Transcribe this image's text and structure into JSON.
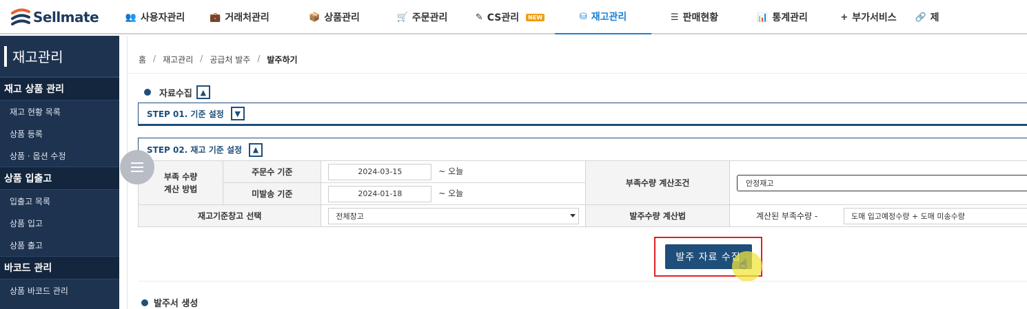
{
  "brand": {
    "name": "Sellmate"
  },
  "nav": [
    {
      "label": "사용자관리",
      "icon": "users-icon",
      "glyph": "👥",
      "active": false
    },
    {
      "label": "거래처관리",
      "icon": "briefcase-icon",
      "glyph": "💼",
      "active": false
    },
    {
      "label": "상품관리",
      "icon": "box-icon",
      "glyph": "📦",
      "active": false
    },
    {
      "label": "주문관리",
      "icon": "cart-icon",
      "glyph": "🛒",
      "active": false
    },
    {
      "label": "CS관리",
      "icon": "edit-icon",
      "glyph": "✎",
      "active": false,
      "badge": "NEW"
    },
    {
      "label": "재고관리",
      "icon": "cubes-icon",
      "glyph": "⛁",
      "active": true
    },
    {
      "label": "판매현황",
      "icon": "list-icon",
      "glyph": "☰",
      "active": false
    },
    {
      "label": "통계관리",
      "icon": "bar-chart-icon",
      "glyph": "📊",
      "active": false
    },
    {
      "label": "부가서비스",
      "icon": "plus-icon",
      "glyph": "+",
      "active": false
    },
    {
      "label": "제",
      "icon": "link-icon",
      "glyph": "🔗",
      "active": false
    }
  ],
  "sidebar": {
    "title": "재고관리",
    "groups": [
      {
        "head": "재고 상품 관리",
        "items": [
          "재고 현황 목록",
          "상품 등록",
          "상품 · 옵션 수정"
        ]
      },
      {
        "head": "상품 입출고",
        "items": [
          "입출고 목록",
          "상품 입고",
          "상품 출고"
        ]
      },
      {
        "head": "바코드 관리",
        "items": [
          "상품 바코드 관리"
        ]
      }
    ]
  },
  "breadcrumb": [
    "홈",
    "재고관리",
    "공급처 발주",
    "발주하기"
  ],
  "section1": {
    "title": "자료수집",
    "toggle": "▲"
  },
  "step1": {
    "label": "STEP 01. 기준 설정",
    "toggle": "▼"
  },
  "step2": {
    "label": "STEP 02. 재고 기준 설정",
    "toggle": "▲"
  },
  "form": {
    "shortage_method_label": "부족 수량\n계산 방법",
    "order_basis_label": "주문수 기준",
    "order_basis_date": "2024-03-15",
    "unshipped_basis_label": "미발송 기준",
    "unshipped_basis_date": "2024-01-18",
    "until_label": "~ 오늘",
    "shortage_condition_label": "부족수량 계산조건",
    "shortage_condition_value": "안정재고",
    "warehouse_label": "재고기준창고 선택",
    "warehouse_value": "전체창고",
    "order_qty_method_label": "발주수량 계산법",
    "calculated_shortage_label": "계산된 부족수량 -",
    "calculated_shortage_value": "도매 입고예정수량 + 도매 미송수량"
  },
  "submit": {
    "label": "발주 자료 수집"
  },
  "section2": {
    "title": "발주서 생성"
  }
}
